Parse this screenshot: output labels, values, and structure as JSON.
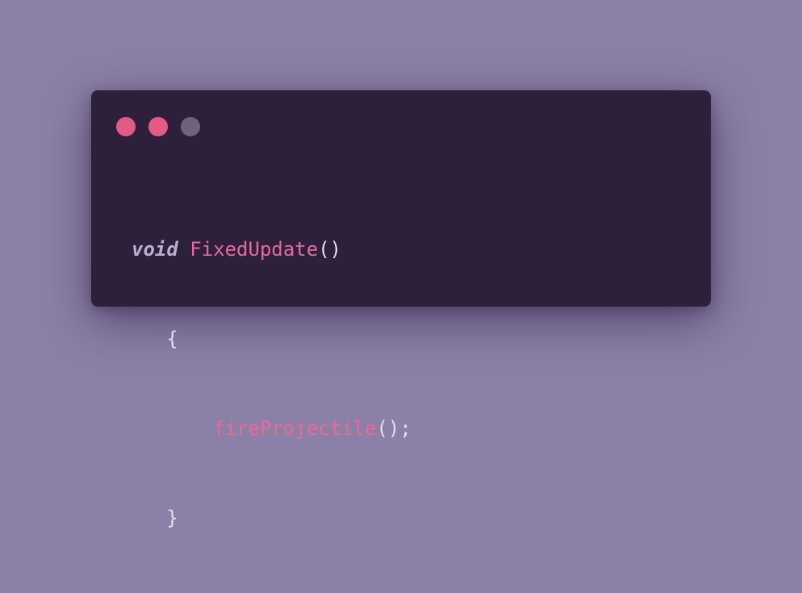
{
  "window": {
    "controls": [
      {
        "name": "close",
        "color": "#e35b85"
      },
      {
        "name": "minimize",
        "color": "#e35b85"
      },
      {
        "name": "maximize",
        "color": "#6c6478"
      }
    ]
  },
  "code": {
    "lines": [
      {
        "keyword": "void",
        "function": "FixedUpdate",
        "punct": "()"
      },
      {
        "indent": "   ",
        "punct": "{"
      },
      {
        "indent": "       ",
        "function": "fireProjectile",
        "punct": "();"
      },
      {
        "indent": "   ",
        "punct": "}"
      }
    ]
  }
}
